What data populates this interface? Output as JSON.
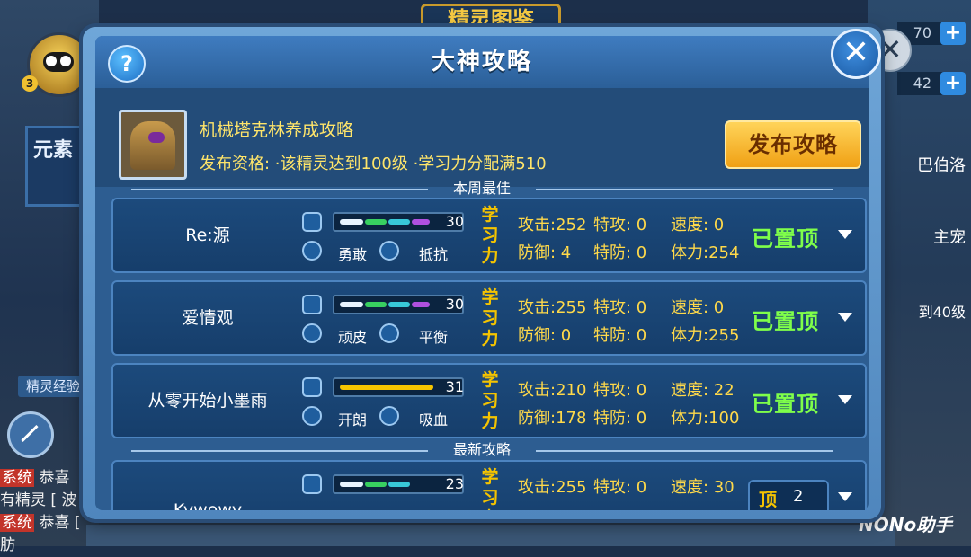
{
  "background": {
    "title": "精灵图鉴",
    "level": "3",
    "element_label": "元素",
    "side_label": "精灵经验",
    "resources": [
      "70",
      "42"
    ],
    "right_labels": [
      "巴伯洛",
      "主宠",
      "到40级"
    ],
    "helper": "NONo助手",
    "chat": [
      {
        "tag": "系统",
        "text": "恭喜"
      },
      {
        "tag": "",
        "text": "有精灵 [ 波"
      },
      {
        "tag": "系统",
        "text": "恭喜 [ 肪"
      }
    ]
  },
  "modal": {
    "title": "大神攻略",
    "help_label": "?",
    "close_label": "✕",
    "guide_name": "机械塔克林养成攻略",
    "guide_requirement": "发布资格: ·该精灵达到100级 ·学习力分配满510",
    "publish_label": "发布攻略",
    "section_weekly": "本周最佳",
    "section_latest": "最新攻略",
    "learn_label": "学习力",
    "rows": [
      {
        "name": "Re:源",
        "bar_value": "30",
        "nature": "勇敢",
        "trait": "抵抗",
        "attack": "攻击:252",
        "sp_attack": "特攻:  0",
        "speed": "速度:  0",
        "defense": "防御:  4",
        "sp_defense": "特防:  0",
        "hp": "体力:254",
        "status": "已置顶"
      },
      {
        "name": "爱情观",
        "bar_value": "30",
        "nature": "顽皮",
        "trait": "平衡",
        "attack": "攻击:255",
        "sp_attack": "特攻:  0",
        "speed": "速度:  0",
        "defense": "防御:  0",
        "sp_defense": "特防:  0",
        "hp": "体力:255",
        "status": "已置顶"
      },
      {
        "name": "从零开始小墨雨",
        "bar_value": "31",
        "nature": "开朗",
        "trait": "吸血",
        "attack": "攻击:210",
        "sp_attack": "特攻:  0",
        "speed": "速度: 22",
        "defense": "防御:178",
        "sp_defense": "特防:  0",
        "hp": "体力:100",
        "status": "已置顶"
      },
      {
        "name": "Kywowy",
        "bar_value": "23",
        "attack": "攻击:255",
        "sp_attack": "特攻:  0",
        "speed": "速度: 30",
        "pin_label": "顶",
        "pin_count": "2"
      }
    ]
  },
  "colors": {
    "seg_white": "#e8f4ff",
    "seg_green": "#38d060",
    "seg_cyan": "#38c8d8",
    "seg_purple": "#b050e0",
    "seg_gold": "#f5c400"
  }
}
